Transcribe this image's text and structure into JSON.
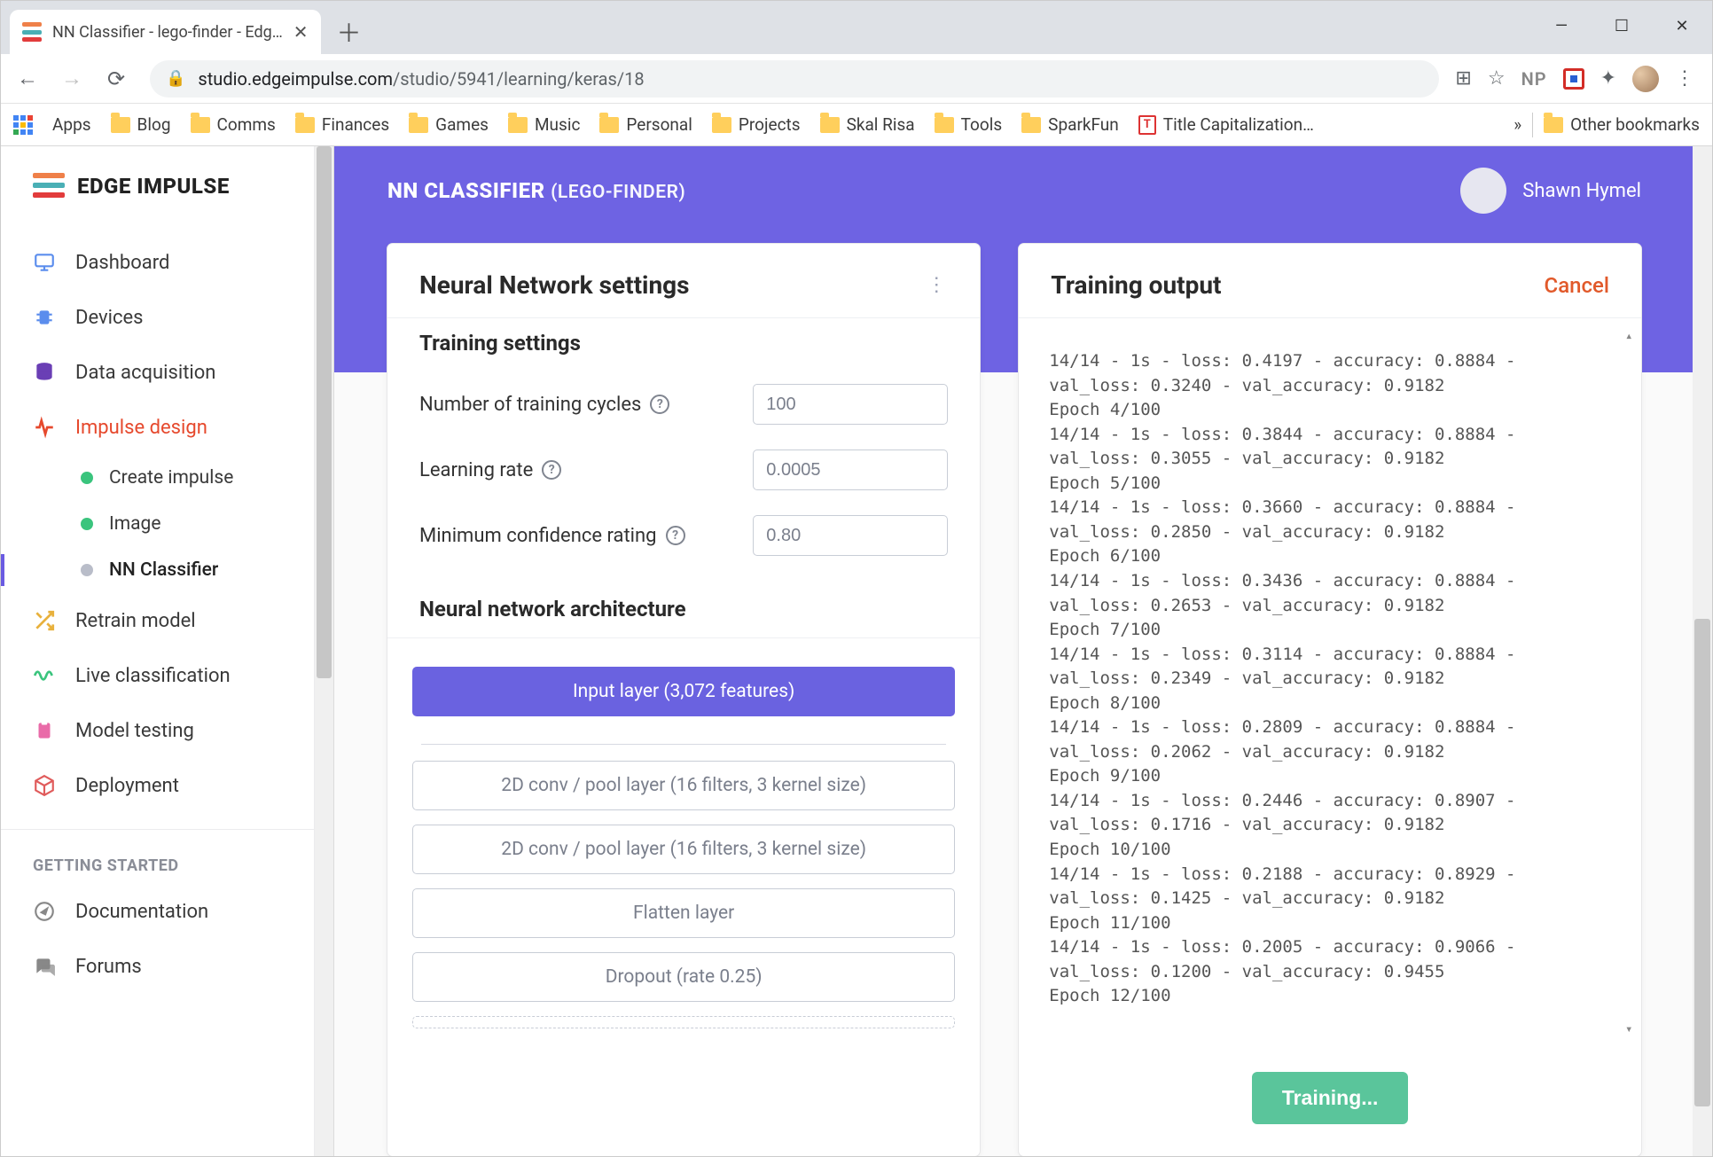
{
  "browser": {
    "tab_title": "NN Classifier - lego-finder - Edg…",
    "url_domain": "studio.edgeimpulse.com",
    "url_path": "/studio/5941/learning/keras/18",
    "apps_label": "Apps",
    "bookmarks": [
      "Blog",
      "Comms",
      "Finances",
      "Games",
      "Music",
      "Personal",
      "Projects",
      "Skal Risa",
      "Tools",
      "SparkFun",
      "Title Capitalization…"
    ],
    "overflow": "»",
    "other_bookmarks": "Other bookmarks",
    "ext_np": "NP"
  },
  "brand": "EDGE IMPULSE",
  "nav": {
    "dashboard": "Dashboard",
    "devices": "Devices",
    "data_acq": "Data acquisition",
    "impulse": "Impulse design",
    "sub_create": "Create impulse",
    "sub_image": "Image",
    "sub_nn": "NN Classifier",
    "retrain": "Retrain model",
    "live": "Live classification",
    "testing": "Model testing",
    "deploy": "Deployment",
    "getting_started": "GETTING STARTED",
    "docs": "Documentation",
    "forums": "Forums"
  },
  "header": {
    "title_main": "NN CLASSIFIER",
    "title_sub": "(LEGO-FINDER)",
    "user": "Shawn Hymel"
  },
  "settings": {
    "card_title": "Neural Network settings",
    "training_title": "Training settings",
    "cycles_label": "Number of training cycles",
    "cycles_value": "100",
    "lr_label": "Learning rate",
    "lr_value": "0.0005",
    "minconf_label": "Minimum confidence rating",
    "minconf_value": "0.80",
    "arch_title": "Neural network architecture",
    "layers": {
      "input": "Input layer (3,072 features)",
      "conv1": "2D conv / pool layer (16 filters, 3 kernel size)",
      "conv2": "2D conv / pool layer (16 filters, 3 kernel size)",
      "flatten": "Flatten layer",
      "dropout": "Dropout (rate 0.25)"
    }
  },
  "output": {
    "title": "Training output",
    "cancel": "Cancel",
    "log": "14/14 - 1s - loss: 0.4197 - accuracy: 0.8884 - val_loss: 0.3240 - val_accuracy: 0.9182\nEpoch 4/100\n14/14 - 1s - loss: 0.3844 - accuracy: 0.8884 - val_loss: 0.3055 - val_accuracy: 0.9182\nEpoch 5/100\n14/14 - 1s - loss: 0.3660 - accuracy: 0.8884 - val_loss: 0.2850 - val_accuracy: 0.9182\nEpoch 6/100\n14/14 - 1s - loss: 0.3436 - accuracy: 0.8884 - val_loss: 0.2653 - val_accuracy: 0.9182\nEpoch 7/100\n14/14 - 1s - loss: 0.3114 - accuracy: 0.8884 - val_loss: 0.2349 - val_accuracy: 0.9182\nEpoch 8/100\n14/14 - 1s - loss: 0.2809 - accuracy: 0.8884 - val_loss: 0.2062 - val_accuracy: 0.9182\nEpoch 9/100\n14/14 - 1s - loss: 0.2446 - accuracy: 0.8907 - val_loss: 0.1716 - val_accuracy: 0.9182\nEpoch 10/100\n14/14 - 1s - loss: 0.2188 - accuracy: 0.8929 - val_loss: 0.1425 - val_accuracy: 0.9182\nEpoch 11/100\n14/14 - 1s - loss: 0.2005 - accuracy: 0.9066 - val_loss: 0.1200 - val_accuracy: 0.9455\nEpoch 12/100",
    "train_btn": "Training..."
  }
}
